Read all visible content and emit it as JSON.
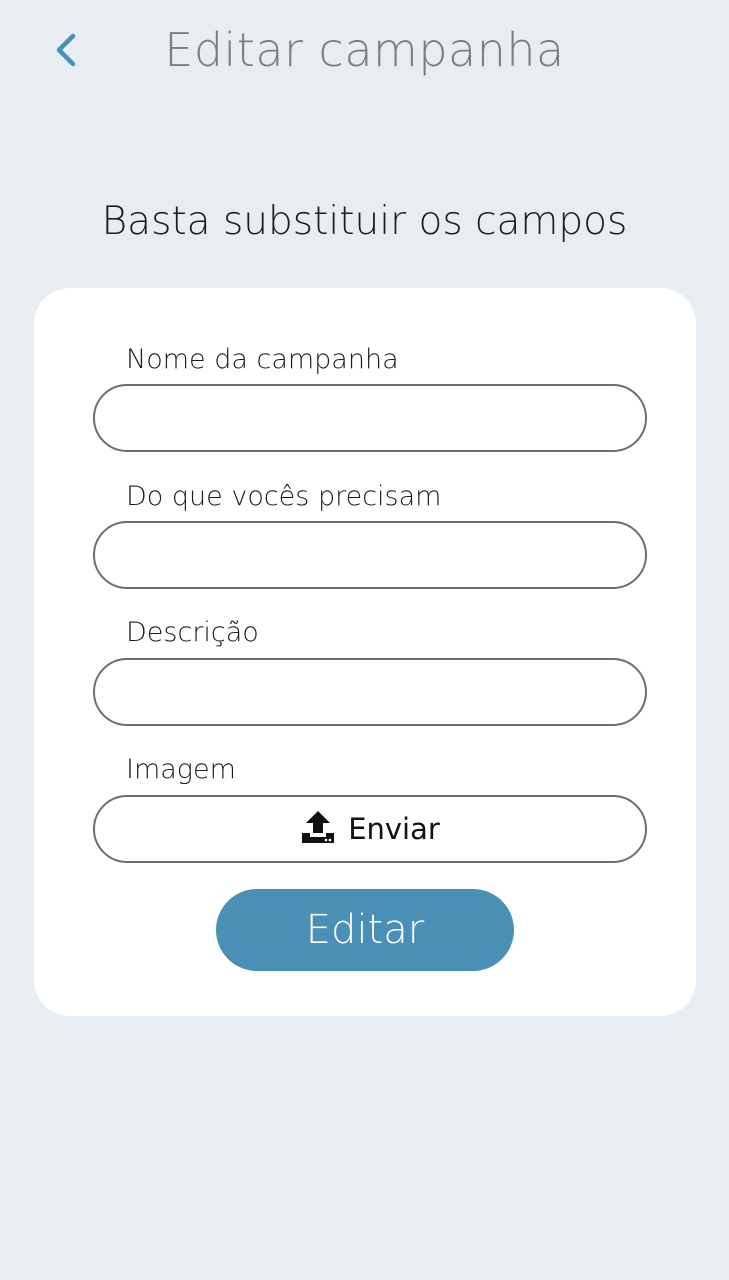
{
  "header": {
    "title": "Editar campanha",
    "back_icon": "chevron-left-icon"
  },
  "subtitle": "Basta substituir os campos",
  "form": {
    "fields": [
      {
        "label": "Nome da campanha",
        "value": "",
        "placeholder": ""
      },
      {
        "label": "Do que vocês precisam",
        "value": "",
        "placeholder": ""
      },
      {
        "label": "Descrição",
        "value": "",
        "placeholder": ""
      }
    ],
    "image": {
      "label": "Imagem",
      "upload_label": "Enviar",
      "upload_icon": "upload-icon"
    },
    "submit_label": "Editar"
  },
  "colors": {
    "background": "#e7edf0",
    "accent": "#4a8fb5",
    "card": "#ffffff",
    "title_text": "#7d7d7d"
  }
}
